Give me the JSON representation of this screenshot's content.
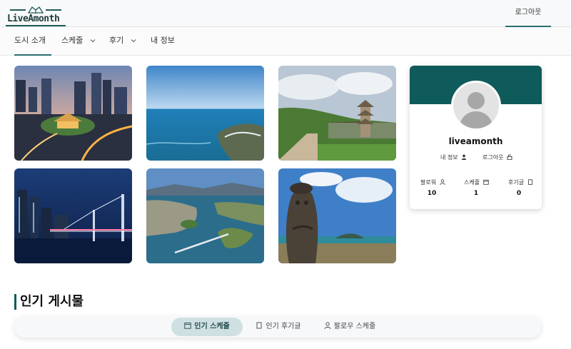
{
  "brand": {
    "name": "LiveAmonth"
  },
  "header": {
    "logout_label": "로그아웃"
  },
  "nav": {
    "items": [
      {
        "label": "도시 소개",
        "active": true,
        "has_dropdown": false
      },
      {
        "label": "스케줄",
        "active": false,
        "has_dropdown": true
      },
      {
        "label": "후기",
        "active": false,
        "has_dropdown": true
      },
      {
        "label": "내 정보",
        "active": false,
        "has_dropdown": false
      }
    ]
  },
  "gallery": {
    "tiles": [
      {
        "subject": "seoul-night-gate"
      },
      {
        "subject": "coastal-sea"
      },
      {
        "subject": "temple-pagoda"
      },
      {
        "subject": "busan-bridge-night"
      },
      {
        "subject": "yeosu-bay-bridge"
      },
      {
        "subject": "jeju-dol-hareubang"
      }
    ]
  },
  "profile": {
    "username": "liveamonth",
    "my_info_label": "내 정보",
    "logout_label": "로그아웃",
    "stats": [
      {
        "label": "팔로워",
        "value": "10",
        "icon": "person-icon"
      },
      {
        "label": "스케줄",
        "value": "1",
        "icon": "calendar-icon"
      },
      {
        "label": "후기글",
        "value": "0",
        "icon": "document-icon"
      }
    ],
    "banner_color": "#0f5a5a"
  },
  "popular": {
    "title": "인기 게시물",
    "tabs": [
      {
        "label": "인기 스케줄",
        "active": true,
        "icon": "calendar-icon"
      },
      {
        "label": "인기 후기글",
        "active": false,
        "icon": "document-icon"
      },
      {
        "label": "팔로우 스케줄",
        "active": false,
        "icon": "person-icon"
      }
    ]
  },
  "colors": {
    "accent": "#0f5a5a",
    "tab_active_bg": "#cfe0e3"
  }
}
